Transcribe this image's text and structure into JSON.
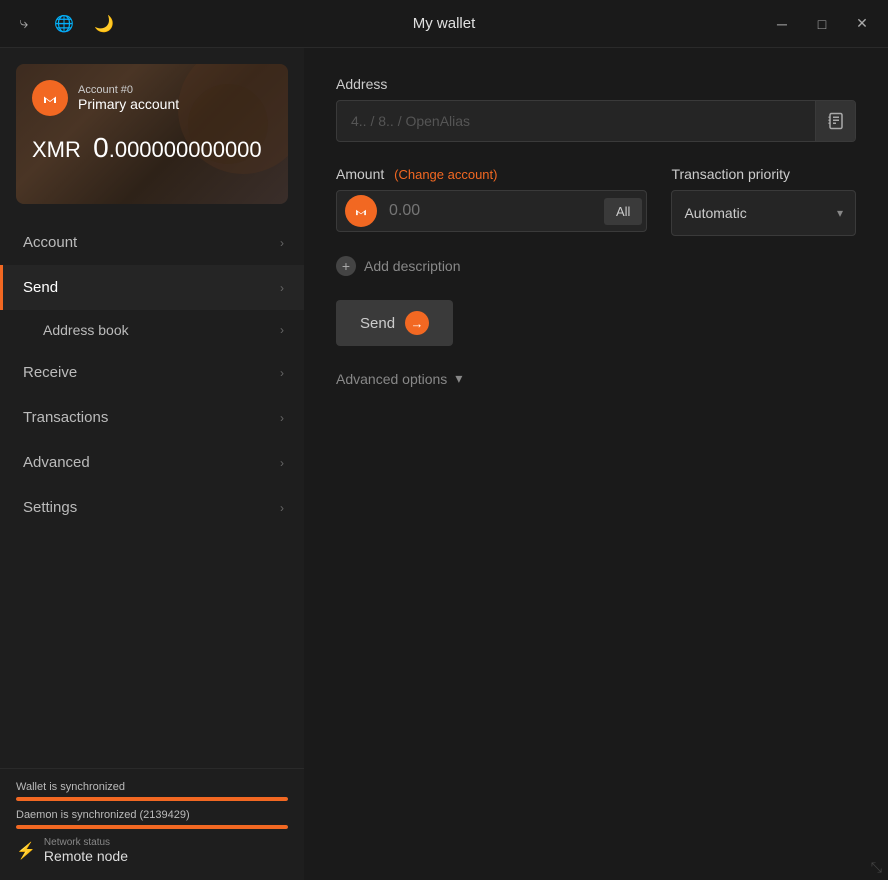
{
  "titleBar": {
    "title": "My wallet",
    "icons": {
      "transfer": "⤷",
      "globe": "🌐",
      "moon": "🌙"
    },
    "winButtons": {
      "minimize": "─",
      "maximize": "□",
      "close": "✕"
    }
  },
  "sidebar": {
    "account": {
      "number": "Account #0",
      "name": "Primary account",
      "currency": "XMR",
      "balance": "0.",
      "balanceDecimals": "000000000000",
      "logo": "M"
    },
    "nav": [
      {
        "id": "account",
        "label": "Account",
        "active": false
      },
      {
        "id": "send",
        "label": "Send",
        "active": true
      },
      {
        "id": "address-book",
        "label": "Address book",
        "sub": true,
        "active": false
      },
      {
        "id": "receive",
        "label": "Receive",
        "active": false
      },
      {
        "id": "transactions",
        "label": "Transactions",
        "active": false
      },
      {
        "id": "advanced",
        "label": "Advanced",
        "active": false
      },
      {
        "id": "settings",
        "label": "Settings",
        "active": false
      }
    ],
    "footer": {
      "walletSync": "Wallet is synchronized",
      "daemonSync": "Daemon is synchronized (2139429)",
      "networkStatusLabel": "Network status",
      "networkNode": "Remote node"
    }
  },
  "content": {
    "addressLabel": "Address",
    "addressPlaceholder": "4.. / 8.. / OpenAlias",
    "amountLabel": "Amount",
    "changeAccountLabel": "(Change account)",
    "amountPlaceholder": "0.00",
    "allButtonLabel": "All",
    "priorityLabel": "Transaction priority",
    "priorityValue": "Automatic",
    "addDescriptionLabel": "Add description",
    "sendButtonLabel": "Send",
    "advancedOptionsLabel": "Advanced options"
  }
}
